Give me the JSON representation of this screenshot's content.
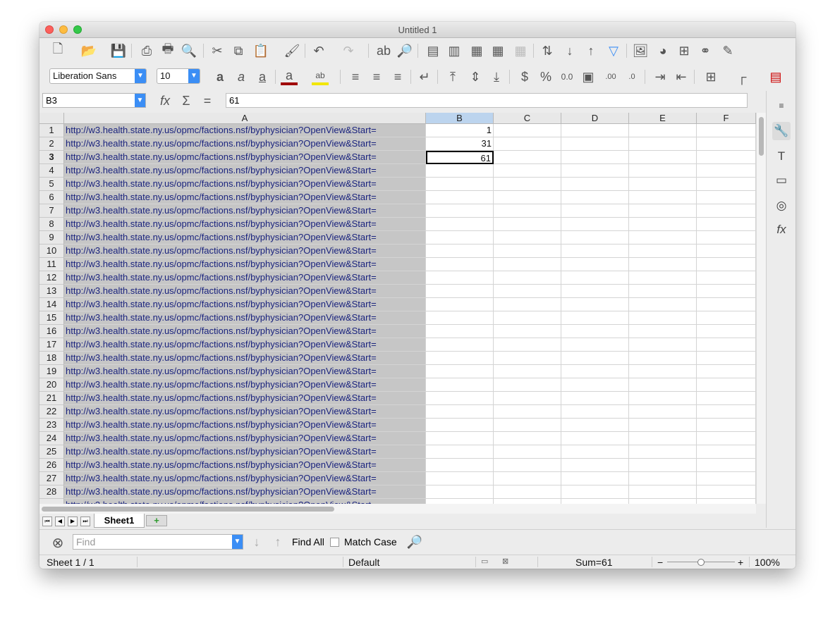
{
  "window": {
    "title": "Untitled 1"
  },
  "toolbar2": {
    "font_name": "Liberation Sans",
    "font_size": "10"
  },
  "formula_bar": {
    "cell_ref": "B3",
    "value": "61"
  },
  "columns": [
    "A",
    "B",
    "C",
    "D",
    "E",
    "F"
  ],
  "rows": {
    "numbers": [
      "1",
      "2",
      "3",
      "4",
      "5",
      "6",
      "7",
      "8",
      "9",
      "10",
      "11",
      "12",
      "13",
      "14",
      "15",
      "16",
      "17",
      "18",
      "19",
      "20",
      "21",
      "22",
      "23",
      "24",
      "25",
      "26",
      "27",
      "28"
    ],
    "url_text": "http://w3.health.state.ny.us/opmc/factions.nsf/byphysician?OpenView&Start=",
    "b_values": [
      "1",
      "31",
      "61"
    ]
  },
  "sheet_tabs": {
    "active": "Sheet1",
    "add_label": "+"
  },
  "find_toolbar": {
    "placeholder": "Find",
    "find_all_label": "Find All",
    "match_case_label": "Match Case"
  },
  "status_bar": {
    "sheet_pos": "Sheet 1 / 1",
    "page_style": "Default",
    "sum": "Sum=61",
    "zoom": "100%"
  },
  "colors": {
    "selection_bg": "#c6c6c6",
    "accent": "#3b8ef5",
    "url_text": "#1a237e"
  }
}
